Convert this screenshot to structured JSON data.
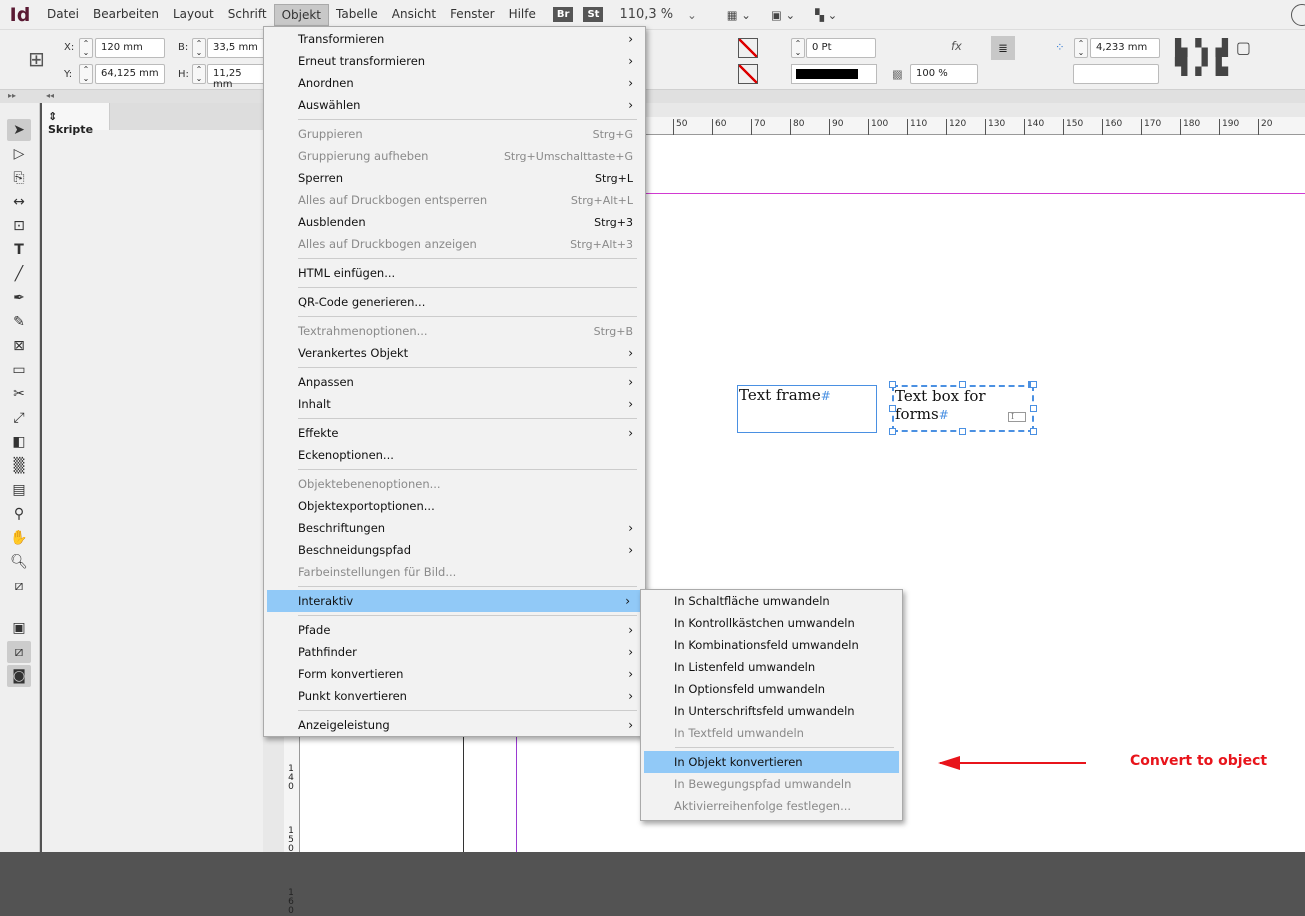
{
  "app": {
    "logo": "Id",
    "menus": [
      "Datei",
      "Bearbeiten",
      "Layout",
      "Schrift",
      "Objekt",
      "Tabelle",
      "Ansicht",
      "Fenster",
      "Hilfe"
    ],
    "active_menu": "Objekt",
    "bridge": "Br",
    "stock": "St",
    "zoom": "110,3 %"
  },
  "control": {
    "x_label": "X:",
    "x": "120 mm",
    "y_label": "Y:",
    "y": "64,125 mm",
    "w_label": "B:",
    "w": "33,5 mm",
    "h_label": "H:",
    "h": "11,25 mm",
    "stroke": "0 Pt",
    "opacity": "100 %",
    "spacing": "4,233 mm"
  },
  "panel": {
    "tab": "Skripte"
  },
  "ruler": {
    "ticks": [
      "50",
      "60",
      "70",
      "80",
      "90",
      "100",
      "110",
      "120",
      "130",
      "140",
      "150",
      "160",
      "170",
      "180",
      "190",
      "20"
    ],
    "vticks": [
      "1 4 0",
      "1 5 0",
      "1 6 0"
    ]
  },
  "canvas": {
    "frame1": "Text frame",
    "frame2": "Text box for forms",
    "hash": "#"
  },
  "menu": {
    "items": [
      {
        "label": "Transformieren",
        "sub": true
      },
      {
        "label": "Erneut transformieren",
        "sub": true
      },
      {
        "label": "Anordnen",
        "sub": true
      },
      {
        "label": "Auswählen",
        "sub": true
      },
      {
        "sep": true
      },
      {
        "label": "Gruppieren",
        "shortcut": "Strg+G",
        "disabled": true
      },
      {
        "label": "Gruppierung aufheben",
        "shortcut": "Strg+Umschalttaste+G",
        "disabled": true
      },
      {
        "label": "Sperren",
        "shortcut": "Strg+L"
      },
      {
        "label": "Alles auf Druckbogen entsperren",
        "shortcut": "Strg+Alt+L",
        "disabled": true
      },
      {
        "label": "Ausblenden",
        "shortcut": "Strg+3"
      },
      {
        "label": "Alles auf Druckbogen anzeigen",
        "shortcut": "Strg+Alt+3",
        "disabled": true
      },
      {
        "sep": true
      },
      {
        "label": "HTML einfügen..."
      },
      {
        "sep": true
      },
      {
        "label": "QR-Code generieren..."
      },
      {
        "sep": true
      },
      {
        "label": "Textrahmenoptionen...",
        "shortcut": "Strg+B",
        "disabled": true
      },
      {
        "label": "Verankertes Objekt",
        "sub": true
      },
      {
        "sep": true
      },
      {
        "label": "Anpassen",
        "sub": true
      },
      {
        "label": "Inhalt",
        "sub": true
      },
      {
        "sep": true
      },
      {
        "label": "Effekte",
        "sub": true
      },
      {
        "label": "Eckenoptionen..."
      },
      {
        "sep": true
      },
      {
        "label": "Objektebenenoptionen...",
        "disabled": true
      },
      {
        "label": "Objektexportoptionen..."
      },
      {
        "label": "Beschriftungen",
        "sub": true
      },
      {
        "label": "Beschneidungspfad",
        "sub": true
      },
      {
        "label": "Farbeinstellungen für Bild...",
        "disabled": true
      },
      {
        "sep": true
      },
      {
        "label": "Interaktiv",
        "sub": true,
        "highlighted": true
      },
      {
        "sep": true
      },
      {
        "label": "Pfade",
        "sub": true
      },
      {
        "label": "Pathfinder",
        "sub": true
      },
      {
        "label": "Form konvertieren",
        "sub": true
      },
      {
        "label": "Punkt konvertieren",
        "sub": true
      },
      {
        "sep": true
      },
      {
        "label": "Anzeigeleistung",
        "sub": true
      }
    ]
  },
  "submenu": {
    "items": [
      {
        "label": "In Schaltfläche umwandeln"
      },
      {
        "label": "In Kontrollkästchen umwandeln"
      },
      {
        "label": "In Kombinationsfeld umwandeln"
      },
      {
        "label": "In Listenfeld umwandeln"
      },
      {
        "label": "In Optionsfeld umwandeln"
      },
      {
        "label": "In Unterschriftsfeld umwandeln"
      },
      {
        "label": "In Textfeld umwandeln",
        "disabled": true
      },
      {
        "sep": true
      },
      {
        "label": "In Objekt konvertieren",
        "highlighted": true
      },
      {
        "label": "In Bewegungspfad umwandeln",
        "disabled": true
      },
      {
        "label": "Aktivierreihenfolge festlegen...",
        "disabled": true
      }
    ]
  },
  "annotation": {
    "text": "Convert to object",
    "color": "#e8141b"
  },
  "colors": {
    "highlight": "#91c9f7",
    "selection": "#4a90e2"
  }
}
